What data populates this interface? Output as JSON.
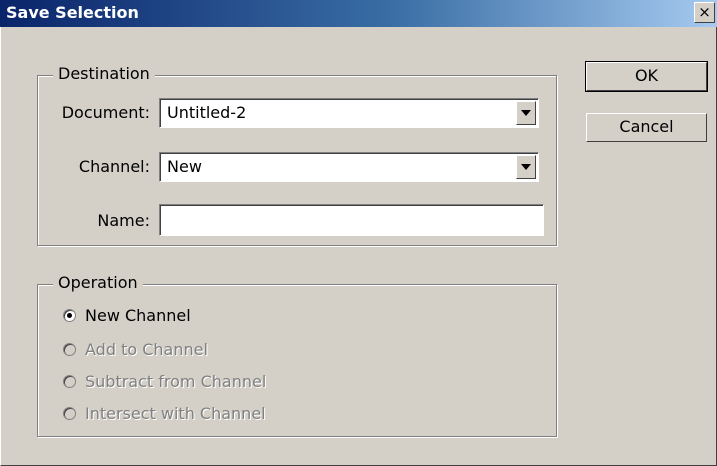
{
  "dialog": {
    "title": "Save Selection",
    "close_label": "×"
  },
  "destination": {
    "legend": "Destination",
    "document_label": "Document:",
    "document_value": "Untitled-2",
    "channel_label": "Channel:",
    "channel_value": "New",
    "name_label": "Name:",
    "name_value": ""
  },
  "operation": {
    "legend": "Operation",
    "options": [
      {
        "label": "New Channel",
        "selected": true,
        "enabled": true
      },
      {
        "label": "Add to Channel",
        "selected": false,
        "enabled": false
      },
      {
        "label": "Subtract from Channel",
        "selected": false,
        "enabled": false
      },
      {
        "label": "Intersect with Channel",
        "selected": false,
        "enabled": false
      }
    ]
  },
  "buttons": {
    "ok": "OK",
    "cancel": "Cancel"
  }
}
